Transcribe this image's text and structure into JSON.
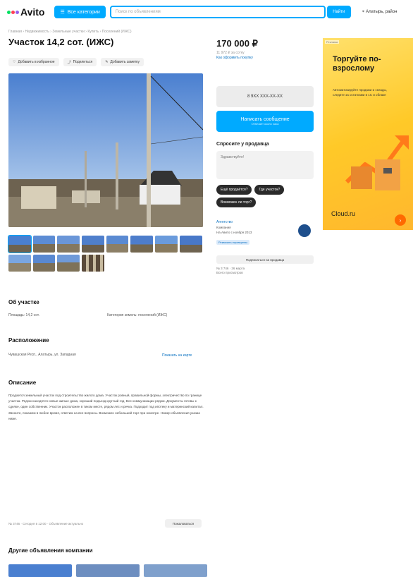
{
  "header": {
    "logo_text": "Avito",
    "logo_colors": [
      "#04e061",
      "#ff4053",
      "#965eeb",
      "#0af"
    ],
    "categories_label": "Все категории",
    "search_placeholder": "Поиск по объявлениям",
    "search_button": "Найти",
    "location": "Алатырь, район"
  },
  "breadcrumb": "Главная › Недвижимость › Земельные участки › Купить › Поселений (ИЖС)",
  "listing": {
    "title": "Участок 14,2 сот. (ИЖС)",
    "actions": [
      {
        "icon": "heart-icon",
        "label": "Добавить в избранное"
      },
      {
        "icon": "share-icon",
        "label": "Поделиться"
      },
      {
        "icon": "note-icon",
        "label": "Добавить заметку"
      }
    ],
    "price": "170 000 ₽",
    "price_note": "11 972 ₽ за сотку",
    "price_link": "Как оформить покупку",
    "phone": "8 9ХХ ХХХ-ХХ-ХХ",
    "message_btn": "Написать сообщение",
    "message_sub": "Отвечает около часа",
    "ask_title": "Спросите у продавца",
    "ask_placeholder": "Здравствуйте!",
    "chips": [
      "Ещё продаётся?",
      "Где участок?",
      "Возможен ли торг?"
    ],
    "seller_name": "Агентство",
    "seller_line1": "Компания",
    "seller_line2": "На Авито с ноября 2013",
    "seller_badge": "Реквизиты проверены",
    "subscribe_btn": "Подписаться на продавца",
    "views_line1": "№ 3 746 · 26 марта",
    "views_line2": "Всего просмотров",
    "thumb_count": 12
  },
  "about": {
    "title": "Об участке",
    "area": "Площадь: 14,2 сот.",
    "category": "Категория земель: поселений (ИЖС)"
  },
  "location_section": {
    "title": "Расположение",
    "address": "Чувашская Респ., Алатырь, ул. Западная",
    "map_link": "Показать на карте"
  },
  "description": {
    "title": "Описание",
    "text": "Продается земельный участок под строительство жилого дома. Участок ровный, правильной формы, электричество по границе участка. Рядом находятся новые жилые дома, хороший подъезд круглый год. Все коммуникации рядом. Документы готовы к сделке, один собственник. Участок расположен в тихом месте, рядом лес и речка. Подходит под ипотеку и материнский капитал. Звоните, покажем в любое время, ответим на все вопросы. Возможен небольшой торг при осмотре. Номер объявления указан ниже."
  },
  "footer": {
    "id_line": "№ 3746 · Сегодня в 12:00 · Объявление актуально",
    "complain_btn": "Пожаловаться",
    "other_title": "Другие объявления компании"
  },
  "ad": {
    "label": "Реклама",
    "title": "Торгуйте по-взрослому",
    "text": "Автоматизируйте продажи и склады, следите за остатками в 1С и облаке",
    "brand": "Cloud.ru",
    "go": "›"
  }
}
